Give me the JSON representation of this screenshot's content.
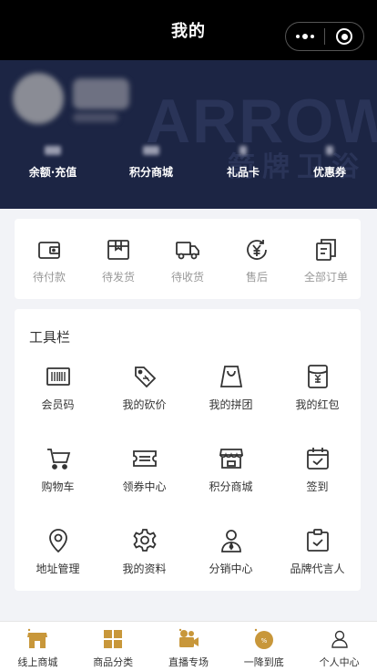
{
  "header": {
    "title": "我的"
  },
  "banner": {
    "watermark_en": "ARROW",
    "watermark_cn": "箭牌卫浴",
    "stats": [
      {
        "label": "余额·充值"
      },
      {
        "label": "积分商城"
      },
      {
        "label": "礼品卡"
      },
      {
        "label": "优惠券"
      }
    ]
  },
  "orders": [
    {
      "label": "待付款",
      "icon": "wallet-icon"
    },
    {
      "label": "待发货",
      "icon": "package-icon"
    },
    {
      "label": "待收货",
      "icon": "truck-icon"
    },
    {
      "label": "售后",
      "icon": "yen-refund-icon"
    },
    {
      "label": "全部订单",
      "icon": "orders-list-icon"
    }
  ],
  "toolbar": {
    "title": "工具栏",
    "items": [
      {
        "label": "会员码",
        "icon": "barcode-icon"
      },
      {
        "label": "我的砍价",
        "icon": "price-tag-icon"
      },
      {
        "label": "我的拼团",
        "icon": "shopping-bag-icon"
      },
      {
        "label": "我的红包",
        "icon": "red-packet-icon"
      },
      {
        "label": "购物车",
        "icon": "cart-icon"
      },
      {
        "label": "领券中心",
        "icon": "ticket-icon"
      },
      {
        "label": "积分商城",
        "icon": "store-icon"
      },
      {
        "label": "签到",
        "icon": "calendar-check-icon"
      },
      {
        "label": "地址管理",
        "icon": "location-pin-icon"
      },
      {
        "label": "我的资料",
        "icon": "gear-icon"
      },
      {
        "label": "分销中心",
        "icon": "person-icon"
      },
      {
        "label": "品牌代言人",
        "icon": "clipboard-check-icon"
      }
    ]
  },
  "tabbar": [
    {
      "label": "线上商城",
      "icon": "shop-icon"
    },
    {
      "label": "商品分类",
      "icon": "category-icon"
    },
    {
      "label": "直播专场",
      "icon": "video-camera-icon"
    },
    {
      "label": "一降到底",
      "icon": "discount-badge-icon"
    },
    {
      "label": "个人中心",
      "icon": "user-icon"
    }
  ],
  "colors": {
    "banner_bg": "#1c2544",
    "accent": "#c8973a",
    "header_bg": "#000000"
  }
}
